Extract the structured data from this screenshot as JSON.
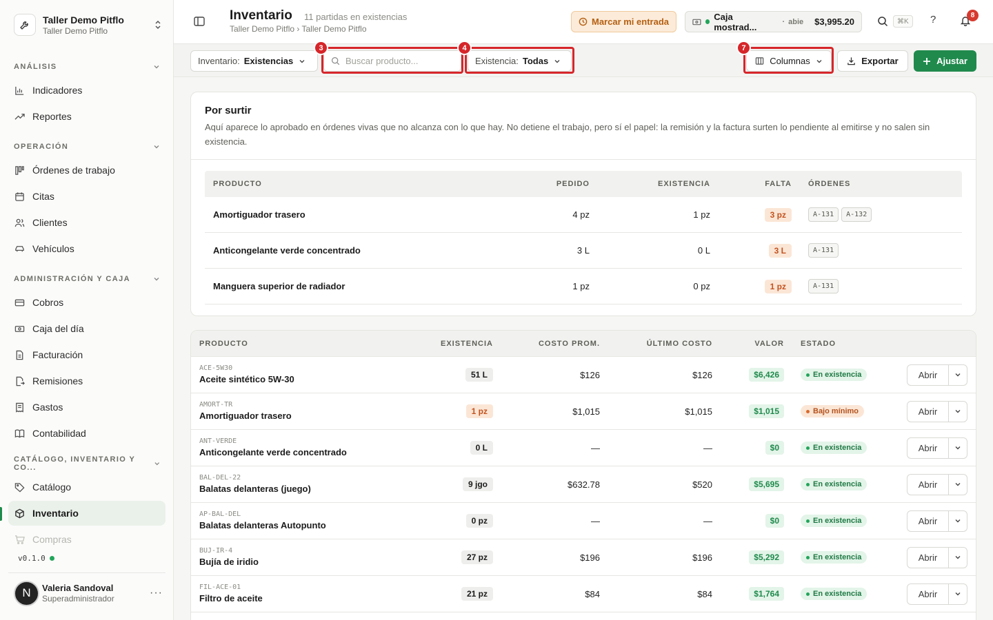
{
  "workspace": {
    "name": "Taller Demo Pitflo",
    "subtitle": "Taller Demo Pitflo"
  },
  "sidebar": {
    "sections": [
      {
        "title": "ANÁLISIS",
        "items": [
          {
            "label": "Indicadores",
            "icon": "bar-chart-icon"
          },
          {
            "label": "Reportes",
            "icon": "trend-icon"
          }
        ]
      },
      {
        "title": "OPERACIÓN",
        "items": [
          {
            "label": "Órdenes de trabajo",
            "icon": "kanban-icon"
          },
          {
            "label": "Citas",
            "icon": "calendar-icon"
          },
          {
            "label": "Clientes",
            "icon": "users-icon"
          },
          {
            "label": "Vehículos",
            "icon": "car-icon"
          }
        ]
      },
      {
        "title": "ADMINISTRACIÓN Y CAJA",
        "items": [
          {
            "label": "Cobros",
            "icon": "card-icon"
          },
          {
            "label": "Caja del día",
            "icon": "cash-icon"
          },
          {
            "label": "Facturación",
            "icon": "document-icon"
          },
          {
            "label": "Remisiones",
            "icon": "file-arrow-icon"
          },
          {
            "label": "Gastos",
            "icon": "receipt-icon"
          },
          {
            "label": "Contabilidad",
            "icon": "book-icon"
          }
        ]
      },
      {
        "title": "CATÁLOGO, INVENTARIO Y CO...",
        "items": [
          {
            "label": "Catálogo",
            "icon": "tag-icon"
          },
          {
            "label": "Inventario",
            "icon": "box-icon"
          },
          {
            "label": "Compras",
            "icon": "cart-icon"
          }
        ]
      }
    ],
    "version": "v0.1.0",
    "user": {
      "initial": "N",
      "name": "Valeria Sandoval",
      "role": "Superadministrador"
    }
  },
  "header": {
    "title": "Inventario",
    "count": "11 partidas en existencias",
    "breadcrumb": "Taller Demo Pitflo › Taller Demo Pitflo",
    "entry_button": "Marcar mi entrada",
    "register": {
      "name": "Caja mostrad...",
      "status": "abie",
      "amount": "$3,995.20"
    },
    "shortcut": "⌘K",
    "help": "?",
    "notifications": "8"
  },
  "toolbar": {
    "inventory_label": "Inventario:",
    "inventory_value": "Existencias",
    "search_placeholder": "Buscar producto...",
    "stock_label": "Existencia:",
    "stock_value": "Todas",
    "columns_label": "Columnas",
    "export_label": "Exportar",
    "adjust_label": "Ajustar",
    "markers": [
      "3",
      "4",
      "7"
    ]
  },
  "por_surtir": {
    "title": "Por surtir",
    "description": "Aquí aparece lo aprobado en órdenes vivas que no alcanza con lo que hay. No detiene el trabajo, pero sí el papel: la remisión y la factura surten lo pendiente al emitirse y no salen sin existencia.",
    "columns": [
      "PRODUCTO",
      "PEDIDO",
      "EXISTENCIA",
      "FALTA",
      "ÓRDENES"
    ],
    "rows": [
      {
        "product": "Amortiguador trasero",
        "ordered": "4 pz",
        "stock": "1 pz",
        "missing": "3 pz",
        "orders": [
          "A-131",
          "A-132"
        ]
      },
      {
        "product": "Anticongelante verde concentrado",
        "ordered": "3 L",
        "stock": "0 L",
        "missing": "3 L",
        "orders": [
          "A-131"
        ]
      },
      {
        "product": "Manguera superior de radiador",
        "ordered": "1 pz",
        "stock": "0 pz",
        "missing": "1 pz",
        "orders": [
          "A-131"
        ]
      }
    ]
  },
  "inventory": {
    "columns": [
      "PRODUCTO",
      "EXISTENCIA",
      "COSTO PROM.",
      "ÚLTIMO COSTO",
      "VALOR",
      "ESTADO"
    ],
    "open_label": "Abrir",
    "rows": [
      {
        "sku": "ACE-5W30",
        "name": "Aceite sintético 5W-30",
        "stock": "51 L",
        "avg_cost": "$126",
        "last_cost": "$126",
        "value": "$6,426",
        "status": "En existencia",
        "low": false
      },
      {
        "sku": "AMORT-TR",
        "name": "Amortiguador trasero",
        "stock": "1 pz",
        "avg_cost": "$1,015",
        "last_cost": "$1,015",
        "value": "$1,015",
        "status": "Bajo mínimo",
        "low": true
      },
      {
        "sku": "ANT-VERDE",
        "name": "Anticongelante verde concentrado",
        "stock": "0 L",
        "avg_cost": "—",
        "last_cost": "—",
        "value": "$0",
        "status": "En existencia",
        "low": false
      },
      {
        "sku": "BAL-DEL-22",
        "name": "Balatas delanteras (juego)",
        "stock": "9 jgo",
        "avg_cost": "$632.78",
        "last_cost": "$520",
        "value": "$5,695",
        "status": "En existencia",
        "low": false
      },
      {
        "sku": "AP-BAL-DEL",
        "name": "Balatas delanteras Autopunto",
        "stock": "0 pz",
        "avg_cost": "—",
        "last_cost": "—",
        "value": "$0",
        "status": "En existencia",
        "low": false
      },
      {
        "sku": "BUJ-IR-4",
        "name": "Bujía de iridio",
        "stock": "27 pz",
        "avg_cost": "$196",
        "last_cost": "$196",
        "value": "$5,292",
        "status": "En existencia",
        "low": false
      },
      {
        "sku": "FIL-ACE-01",
        "name": "Filtro de aceite",
        "stock": "21 pz",
        "avg_cost": "$84",
        "last_cost": "$84",
        "value": "$1,764",
        "status": "En existencia",
        "low": false
      },
      {
        "sku": "",
        "name": "",
        "stock": "",
        "avg_cost": "",
        "last_cost": "",
        "value": "",
        "status": "",
        "low": false
      }
    ]
  }
}
